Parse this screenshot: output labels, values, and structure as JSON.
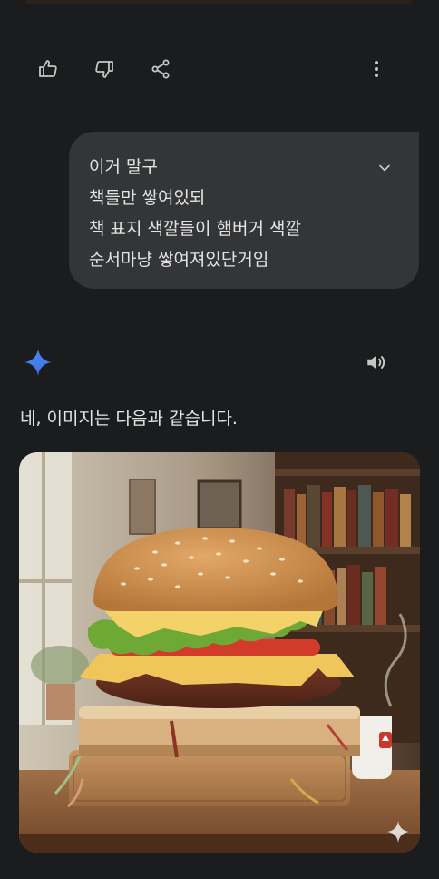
{
  "user_message": {
    "lines": [
      "이거 말구",
      "책들만 쌓여있되",
      "책 표지 색깔들이 햄버거 색깔",
      "순서마냥 쌓여져있단거임"
    ]
  },
  "response": {
    "text": "네, 이미지는 다음과 같습니다."
  },
  "colors": {
    "background": "#1b1c1e",
    "bubble": "#333537",
    "text": "#e3e3e3",
    "gemini_blue": "#4285f4"
  },
  "icons": [
    "thumbs-up-icon",
    "thumbs-down-icon",
    "share-icon",
    "more-vert-icon",
    "chevron-down-icon",
    "gemini-sparkle-icon",
    "speaker-icon",
    "sparkle-watermark-icon"
  ]
}
